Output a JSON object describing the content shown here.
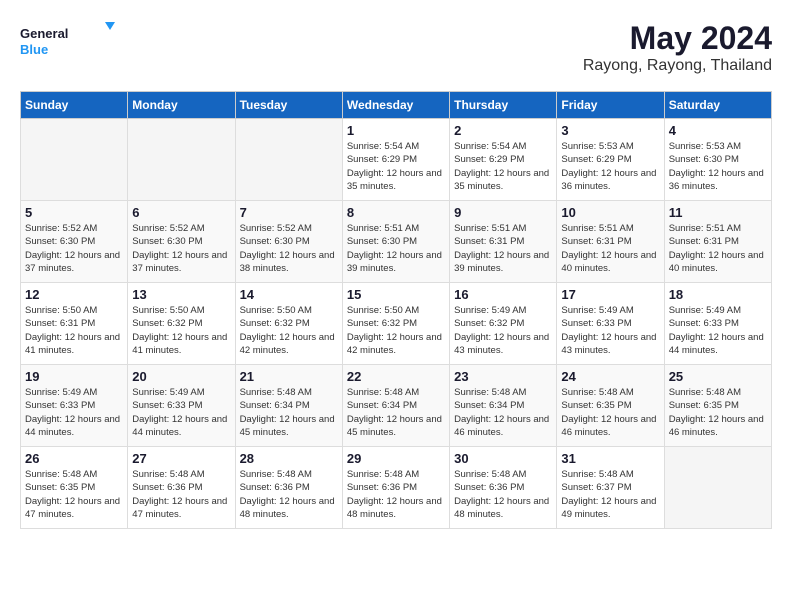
{
  "logo": {
    "text_general": "General",
    "text_blue": "Blue"
  },
  "title": {
    "month_year": "May 2024",
    "location": "Rayong, Rayong, Thailand"
  },
  "weekdays": [
    "Sunday",
    "Monday",
    "Tuesday",
    "Wednesday",
    "Thursday",
    "Friday",
    "Saturday"
  ],
  "weeks": [
    [
      {
        "day": "",
        "sunrise": "",
        "sunset": "",
        "daylight": ""
      },
      {
        "day": "",
        "sunrise": "",
        "sunset": "",
        "daylight": ""
      },
      {
        "day": "",
        "sunrise": "",
        "sunset": "",
        "daylight": ""
      },
      {
        "day": "1",
        "sunrise": "Sunrise: 5:54 AM",
        "sunset": "Sunset: 6:29 PM",
        "daylight": "Daylight: 12 hours and 35 minutes."
      },
      {
        "day": "2",
        "sunrise": "Sunrise: 5:54 AM",
        "sunset": "Sunset: 6:29 PM",
        "daylight": "Daylight: 12 hours and 35 minutes."
      },
      {
        "day": "3",
        "sunrise": "Sunrise: 5:53 AM",
        "sunset": "Sunset: 6:29 PM",
        "daylight": "Daylight: 12 hours and 36 minutes."
      },
      {
        "day": "4",
        "sunrise": "Sunrise: 5:53 AM",
        "sunset": "Sunset: 6:30 PM",
        "daylight": "Daylight: 12 hours and 36 minutes."
      }
    ],
    [
      {
        "day": "5",
        "sunrise": "Sunrise: 5:52 AM",
        "sunset": "Sunset: 6:30 PM",
        "daylight": "Daylight: 12 hours and 37 minutes."
      },
      {
        "day": "6",
        "sunrise": "Sunrise: 5:52 AM",
        "sunset": "Sunset: 6:30 PM",
        "daylight": "Daylight: 12 hours and 37 minutes."
      },
      {
        "day": "7",
        "sunrise": "Sunrise: 5:52 AM",
        "sunset": "Sunset: 6:30 PM",
        "daylight": "Daylight: 12 hours and 38 minutes."
      },
      {
        "day": "8",
        "sunrise": "Sunrise: 5:51 AM",
        "sunset": "Sunset: 6:30 PM",
        "daylight": "Daylight: 12 hours and 39 minutes."
      },
      {
        "day": "9",
        "sunrise": "Sunrise: 5:51 AM",
        "sunset": "Sunset: 6:31 PM",
        "daylight": "Daylight: 12 hours and 39 minutes."
      },
      {
        "day": "10",
        "sunrise": "Sunrise: 5:51 AM",
        "sunset": "Sunset: 6:31 PM",
        "daylight": "Daylight: 12 hours and 40 minutes."
      },
      {
        "day": "11",
        "sunrise": "Sunrise: 5:51 AM",
        "sunset": "Sunset: 6:31 PM",
        "daylight": "Daylight: 12 hours and 40 minutes."
      }
    ],
    [
      {
        "day": "12",
        "sunrise": "Sunrise: 5:50 AM",
        "sunset": "Sunset: 6:31 PM",
        "daylight": "Daylight: 12 hours and 41 minutes."
      },
      {
        "day": "13",
        "sunrise": "Sunrise: 5:50 AM",
        "sunset": "Sunset: 6:32 PM",
        "daylight": "Daylight: 12 hours and 41 minutes."
      },
      {
        "day": "14",
        "sunrise": "Sunrise: 5:50 AM",
        "sunset": "Sunset: 6:32 PM",
        "daylight": "Daylight: 12 hours and 42 minutes."
      },
      {
        "day": "15",
        "sunrise": "Sunrise: 5:50 AM",
        "sunset": "Sunset: 6:32 PM",
        "daylight": "Daylight: 12 hours and 42 minutes."
      },
      {
        "day": "16",
        "sunrise": "Sunrise: 5:49 AM",
        "sunset": "Sunset: 6:32 PM",
        "daylight": "Daylight: 12 hours and 43 minutes."
      },
      {
        "day": "17",
        "sunrise": "Sunrise: 5:49 AM",
        "sunset": "Sunset: 6:33 PM",
        "daylight": "Daylight: 12 hours and 43 minutes."
      },
      {
        "day": "18",
        "sunrise": "Sunrise: 5:49 AM",
        "sunset": "Sunset: 6:33 PM",
        "daylight": "Daylight: 12 hours and 44 minutes."
      }
    ],
    [
      {
        "day": "19",
        "sunrise": "Sunrise: 5:49 AM",
        "sunset": "Sunset: 6:33 PM",
        "daylight": "Daylight: 12 hours and 44 minutes."
      },
      {
        "day": "20",
        "sunrise": "Sunrise: 5:49 AM",
        "sunset": "Sunset: 6:33 PM",
        "daylight": "Daylight: 12 hours and 44 minutes."
      },
      {
        "day": "21",
        "sunrise": "Sunrise: 5:48 AM",
        "sunset": "Sunset: 6:34 PM",
        "daylight": "Daylight: 12 hours and 45 minutes."
      },
      {
        "day": "22",
        "sunrise": "Sunrise: 5:48 AM",
        "sunset": "Sunset: 6:34 PM",
        "daylight": "Daylight: 12 hours and 45 minutes."
      },
      {
        "day": "23",
        "sunrise": "Sunrise: 5:48 AM",
        "sunset": "Sunset: 6:34 PM",
        "daylight": "Daylight: 12 hours and 46 minutes."
      },
      {
        "day": "24",
        "sunrise": "Sunrise: 5:48 AM",
        "sunset": "Sunset: 6:35 PM",
        "daylight": "Daylight: 12 hours and 46 minutes."
      },
      {
        "day": "25",
        "sunrise": "Sunrise: 5:48 AM",
        "sunset": "Sunset: 6:35 PM",
        "daylight": "Daylight: 12 hours and 46 minutes."
      }
    ],
    [
      {
        "day": "26",
        "sunrise": "Sunrise: 5:48 AM",
        "sunset": "Sunset: 6:35 PM",
        "daylight": "Daylight: 12 hours and 47 minutes."
      },
      {
        "day": "27",
        "sunrise": "Sunrise: 5:48 AM",
        "sunset": "Sunset: 6:36 PM",
        "daylight": "Daylight: 12 hours and 47 minutes."
      },
      {
        "day": "28",
        "sunrise": "Sunrise: 5:48 AM",
        "sunset": "Sunset: 6:36 PM",
        "daylight": "Daylight: 12 hours and 48 minutes."
      },
      {
        "day": "29",
        "sunrise": "Sunrise: 5:48 AM",
        "sunset": "Sunset: 6:36 PM",
        "daylight": "Daylight: 12 hours and 48 minutes."
      },
      {
        "day": "30",
        "sunrise": "Sunrise: 5:48 AM",
        "sunset": "Sunset: 6:36 PM",
        "daylight": "Daylight: 12 hours and 48 minutes."
      },
      {
        "day": "31",
        "sunrise": "Sunrise: 5:48 AM",
        "sunset": "Sunset: 6:37 PM",
        "daylight": "Daylight: 12 hours and 49 minutes."
      },
      {
        "day": "",
        "sunrise": "",
        "sunset": "",
        "daylight": ""
      }
    ]
  ]
}
